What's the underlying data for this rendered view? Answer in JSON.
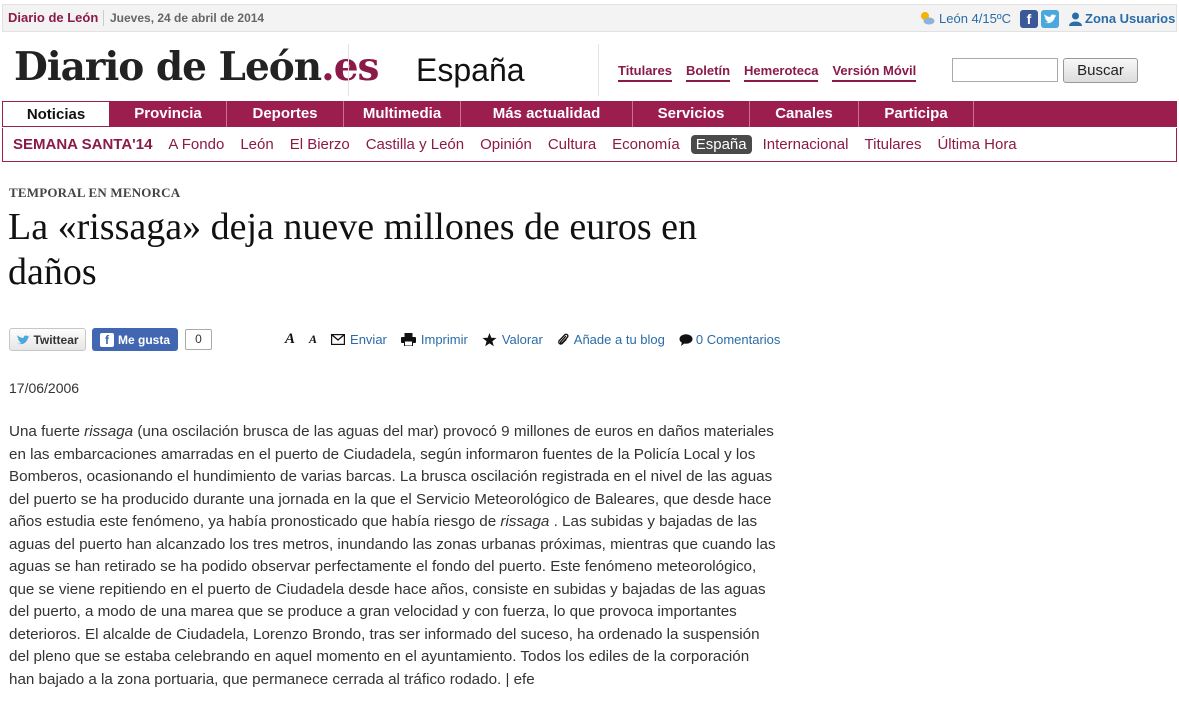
{
  "topbar": {
    "brand": "Diario de León",
    "date": "Jueves, 24 de abril de 2014",
    "weather": "León 4/15ºC",
    "facebook_icon": "f",
    "user_zone": "Zona Usuarios"
  },
  "header": {
    "logo_main": "Diario de León",
    "logo_suffix": ".es",
    "section_title": "España",
    "links": [
      "Titulares",
      "Boletín",
      "Hemeroteca",
      "Versión Móvil"
    ],
    "search": {
      "value": "",
      "button": "Buscar"
    }
  },
  "main_nav": [
    {
      "label": "Noticias",
      "active": true
    },
    {
      "label": "Provincia"
    },
    {
      "label": "Deportes"
    },
    {
      "label": "Multimedia"
    },
    {
      "label": "Más actualidad"
    },
    {
      "label": "Servicios"
    },
    {
      "label": "Canales"
    },
    {
      "label": "Participa"
    }
  ],
  "sub_nav": [
    "SEMANA SANTA'14",
    "A Fondo",
    "León",
    "El Bierzo",
    "Castilla y León",
    "Opinión",
    "Cultura",
    "Economía",
    "España",
    "Internacional",
    "Titulares",
    "Última Hora"
  ],
  "sub_nav_active": "España",
  "article": {
    "kicker": "TEMPORAL EN MENORCA",
    "headline": "La «rissaga» deja nueve millones de euros en daños",
    "social": {
      "twitter": "Twittear",
      "facebook": "Me gusta",
      "like_count": "0"
    },
    "tools": {
      "font_up": "A",
      "font_down": "A",
      "send": "Enviar",
      "print": "Imprimir",
      "rate": "Valorar",
      "blog": "Añade a tu blog",
      "comments": "0 Comentarios"
    },
    "date": "17/06/2006",
    "body": {
      "p1_a": "Una fuerte ",
      "p1_em1": "rissaga",
      "p1_b": " (una oscilación brusca de las aguas del mar) provocó 9 millones de euros en daños materiales en las embarcaciones amarradas en el puerto de Ciudadela, según informaron fuentes de la Policía Local y los Bomberos, ocasionando el hundimiento de varias barcas. La brusca oscilación registrada en el nivel de las aguas del puerto se ha producido durante una jornada en la que el Servicio Meteorológico de Baleares, que desde hace años estudia este fenómeno, ya había pronosticado que había riesgo de ",
      "p1_em2": "rissaga",
      "p1_c": " . Las subidas y bajadas de las aguas del puerto han alcanzado los tres metros, inundando las zonas urbanas próximas, mientras que cuando las aguas se han retirado se ha podido observar perfectamente el fondo del puerto. Este fenómeno meteorológico, que se viene repitiendo en el puerto de Ciudadela desde hace años, consiste en subidas y bajadas de las aguas del puerto, a modo de una marea que se produce a gran velocidad y con fuerza, lo que provoca importantes deterioros. El alcalde de Ciudadela, Lorenzo Brondo, tras ser informado del suceso, ha ordenado la suspensión del pleno que se estaba celebrando en aquel momento en el ayuntamiento. Todos los ediles de la corporación han bajado a la zona portuaria, que permanece cerrada al tráfico rodado. | efe"
    }
  }
}
